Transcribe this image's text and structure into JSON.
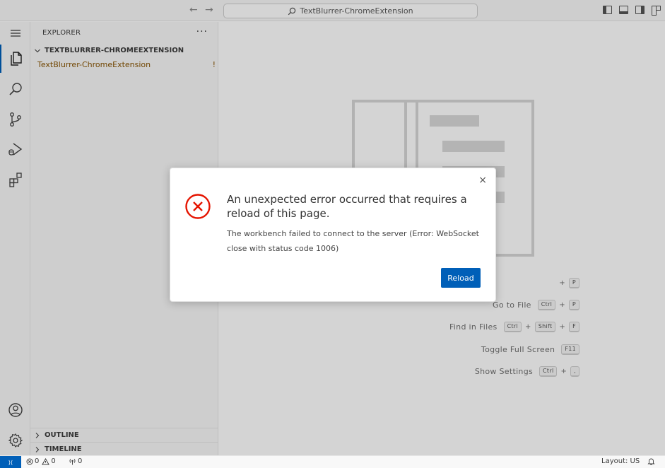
{
  "titlebar": {
    "back_glyph": "←",
    "forward_glyph": "→",
    "search_text": "TextBlurrer-ChromeExtension"
  },
  "sidebar": {
    "title": "EXPLORER",
    "more": "···",
    "root_folder": "TEXTBLURRER-CHROMEEXTENSION",
    "items": [
      {
        "name": "TextBlurrer-ChromeExtension",
        "badge": "!"
      }
    ],
    "outline": "OUTLINE",
    "timeline": "TIMELINE"
  },
  "shortcuts": [
    {
      "label": "",
      "keys": [
        "P"
      ]
    },
    {
      "label": "Go to File",
      "keys": [
        "Ctrl",
        "P"
      ]
    },
    {
      "label": "Find in Files",
      "keys": [
        "Ctrl",
        "Shift",
        "F"
      ]
    },
    {
      "label": "Toggle Full Screen",
      "keys": [
        "F11"
      ]
    },
    {
      "label": "Show Settings",
      "keys": [
        "Ctrl",
        ","
      ]
    }
  ],
  "dialog": {
    "close": "×",
    "title": "An unexpected error occurred that requires a reload of this page.",
    "detail": "The workbench failed to connect to the server (Error: WebSocket close with status code 1006)",
    "button": "Reload"
  },
  "statusbar": {
    "remote_glyph": "⟩⟨",
    "errors": "0",
    "warnings": "0",
    "ports": "0",
    "layout": "Layout: US"
  },
  "colors": {
    "accent": "#005fb8",
    "error_red": "#e51400",
    "modified_gold": "#895503"
  }
}
